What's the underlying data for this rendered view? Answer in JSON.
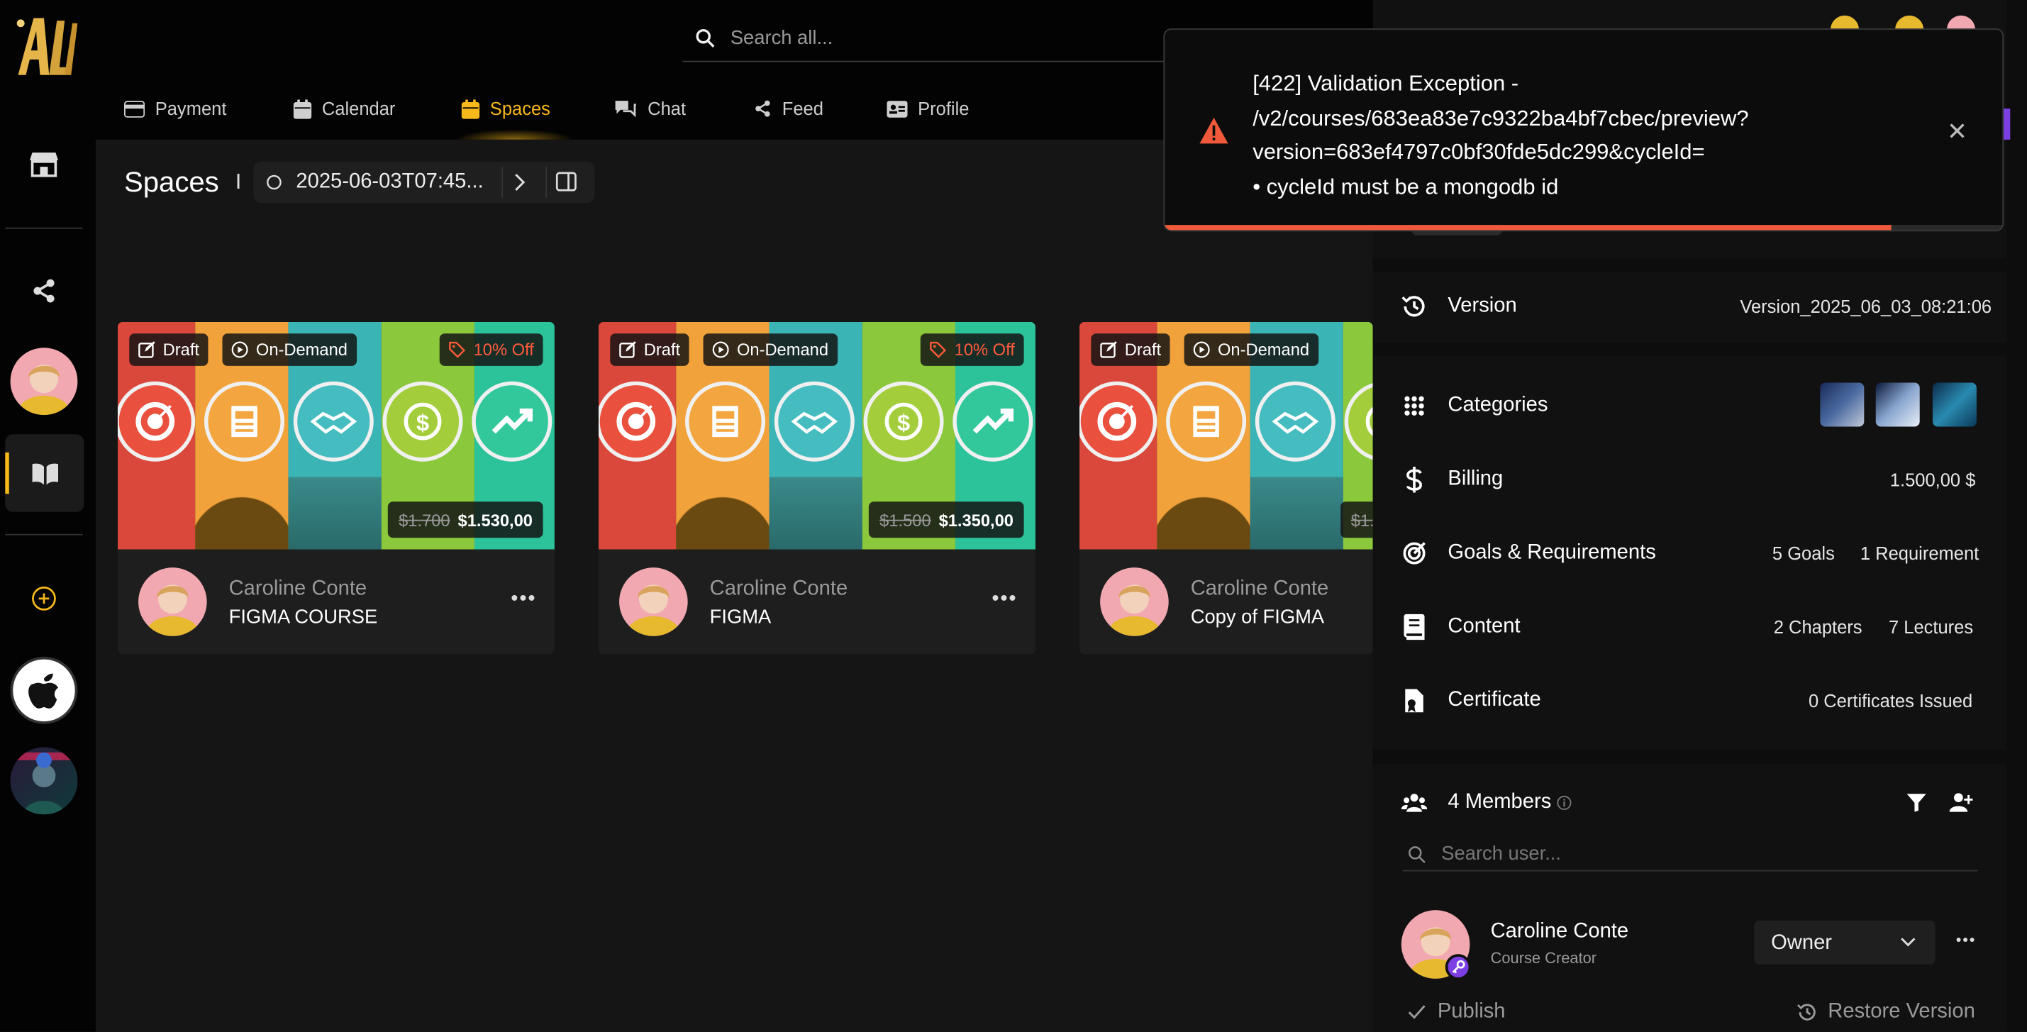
{
  "search": {
    "placeholder": "Search all..."
  },
  "tabs": [
    {
      "label": "Payment",
      "icon": "payment-card-icon"
    },
    {
      "label": "Calendar",
      "icon": "calendar-icon"
    },
    {
      "label": "Spaces",
      "icon": "spaces-icon",
      "active": true
    },
    {
      "label": "Chat",
      "icon": "chat-icon"
    },
    {
      "label": "Feed",
      "icon": "share-icon"
    },
    {
      "label": "Profile",
      "icon": "id-card-icon"
    }
  ],
  "page": {
    "title": "Spaces",
    "separator": "I",
    "version_label": "2025-06-03T07:45..."
  },
  "cards": [
    {
      "badges": {
        "draft": "Draft",
        "type": "On-Demand",
        "discount": "10% Off"
      },
      "old_price": "$1.700",
      "price": "$1.530,00",
      "author": "Caroline Conte",
      "title": "FIGMA COURSE",
      "more": "•••"
    },
    {
      "badges": {
        "draft": "Draft",
        "type": "On-Demand",
        "discount": "10% Off"
      },
      "old_price": "$1.500",
      "price": "$1.350,00",
      "author": "Caroline Conte",
      "title": "FIGMA",
      "more": "•••"
    },
    {
      "badges": {
        "draft": "Draft",
        "type": "On-Demand"
      },
      "old_price": "$1.",
      "author": "Caroline Conte",
      "title": "Copy of FIGMA"
    }
  ],
  "panel": {
    "version": {
      "label": "Version",
      "value": "Version_2025_06_03_08:21:06"
    },
    "categories": {
      "label": "Categories"
    },
    "billing": {
      "label": "Billing",
      "value": "1.500,00 $"
    },
    "goals": {
      "label": "Goals & Requirements",
      "goals": "5 Goals",
      "requirements": "1 Requirement"
    },
    "content": {
      "label": "Content",
      "chapters": "2 Chapters",
      "lectures": "7 Lectures"
    },
    "certificate": {
      "label": "Certificate",
      "value": "0 Certificates Issued"
    },
    "members": {
      "label": "4 Members",
      "search_placeholder": "Search user...",
      "list": [
        {
          "name": "Caroline Conte",
          "role_desc": "Course Creator",
          "role": "Owner"
        }
      ]
    },
    "actions": {
      "publish": "Publish",
      "restore": "Restore Version"
    }
  },
  "toast": {
    "line1": "[422] Validation Exception -",
    "line2": "/v2/courses/683ea83e7c9322ba4bf7cbec/preview?",
    "line3": "version=683ef4797c0bf30fde5dc299&cycleId=",
    "line4": "• cycleId must be a mongodb id",
    "close": "✕",
    "progress": 0.865
  },
  "colors": {
    "accent": "#f6b81a",
    "danger": "#f05a3a",
    "purple": "#7b3fe4"
  }
}
